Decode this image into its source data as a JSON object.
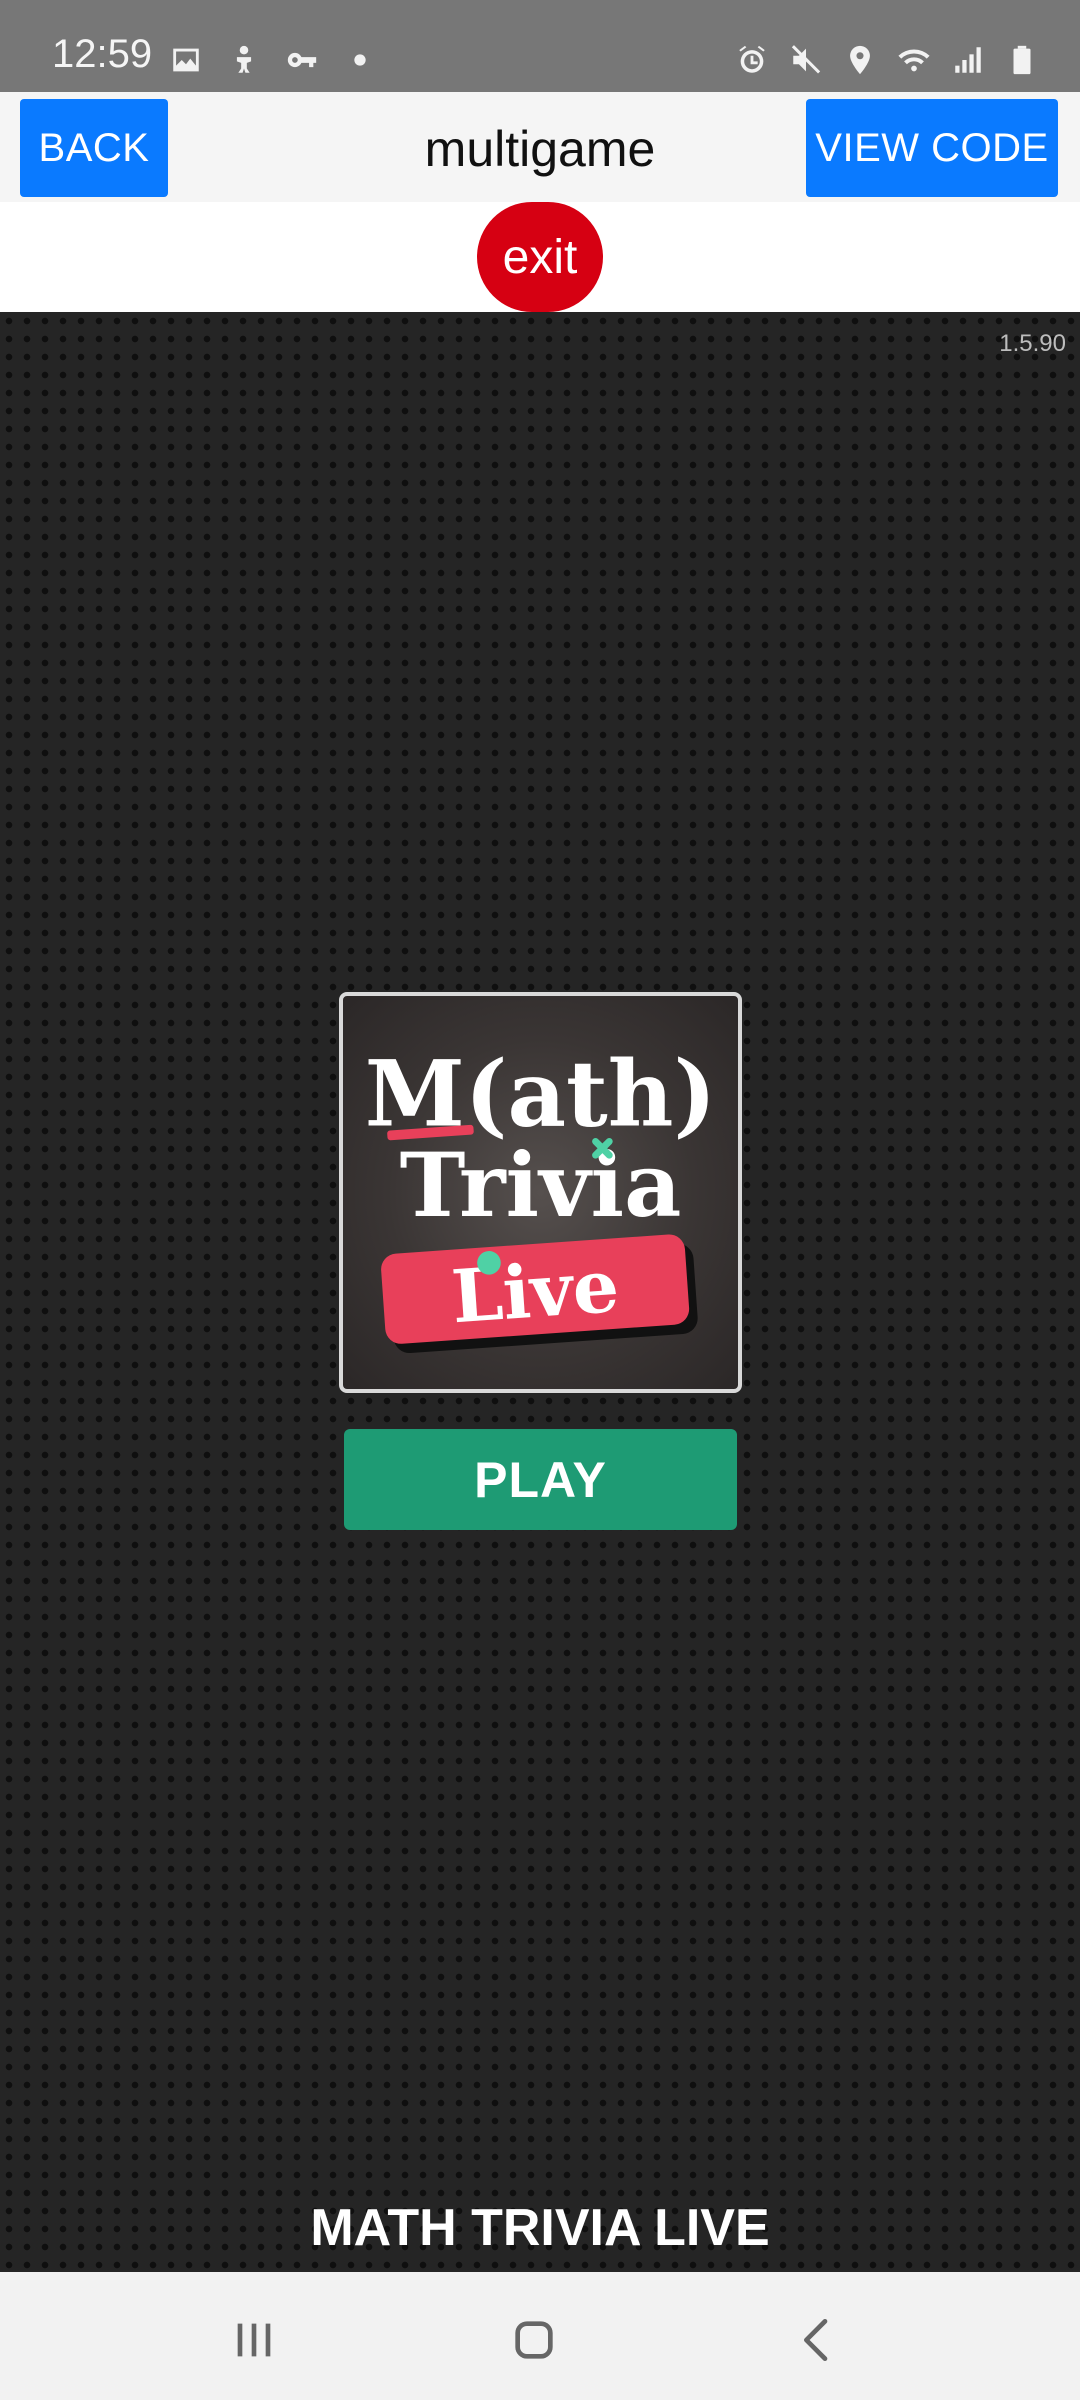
{
  "status_bar": {
    "time": "12:59",
    "left_icons": [
      "image-icon",
      "accessibility-icon",
      "key-icon",
      "dot-icon"
    ],
    "right_icons": [
      "alarm-icon",
      "mute-icon",
      "location-icon",
      "wifi-icon",
      "signal-icon",
      "battery-icon"
    ]
  },
  "header": {
    "back_label": "BACK",
    "title": "multigame",
    "view_code_label": "VIEW CODE"
  },
  "exit_label": "exit",
  "game": {
    "version": "1.5.90",
    "logo": {
      "line1": "M(ath)",
      "line2": "Trivia",
      "line3": "Live"
    },
    "play_label": "PLAY",
    "title": "MATH TRIVIA LIVE"
  },
  "colors": {
    "header_button": "#0a7aff",
    "exit_button": "#d60012",
    "play_button": "#1e9b74",
    "logo_live_banner": "#e8405a"
  },
  "nav_bar": {
    "buttons": [
      "recents-icon",
      "home-icon",
      "back-icon"
    ]
  }
}
